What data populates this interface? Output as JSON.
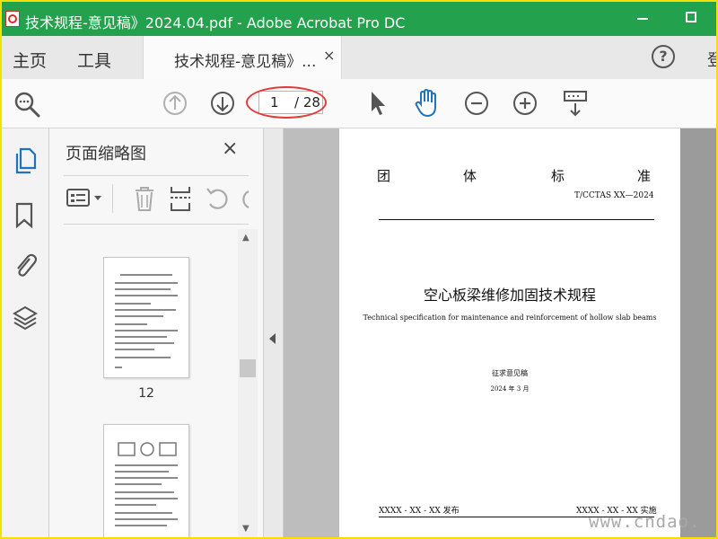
{
  "window": {
    "title": "技术规程-意见稿》2024.04.pdf - Adobe Acrobat Pro DC"
  },
  "menu": {
    "home": "主页",
    "tools": "工具",
    "doc_tab": "技术规程-意见稿》...",
    "tab_close": "×",
    "help": "?",
    "login": "登"
  },
  "toolbar": {
    "page_current": "1",
    "page_total": "/ 28"
  },
  "thumbnails": {
    "title": "页面缩略图",
    "close": "×",
    "page_label": "12"
  },
  "document": {
    "header_chars": [
      "团",
      "体",
      "标",
      "准"
    ],
    "code": "T/CCTAS  XX—2024",
    "title": "空心板梁维修加固技术规程",
    "subtitle": "Technical specification for maintenance and reinforcement of hollow slab beams",
    "status": "征求意见稿",
    "date": "2024 年 3 月",
    "publish": "XXXX - XX - XX 发布",
    "implement": "XXXX - XX - XX 实施"
  },
  "watermark": "www.cndao.",
  "colors": {
    "titlebar": "#23a14c",
    "active_icon": "#1e73be",
    "annotation": "#e53935",
    "frame": "#f5e100"
  }
}
